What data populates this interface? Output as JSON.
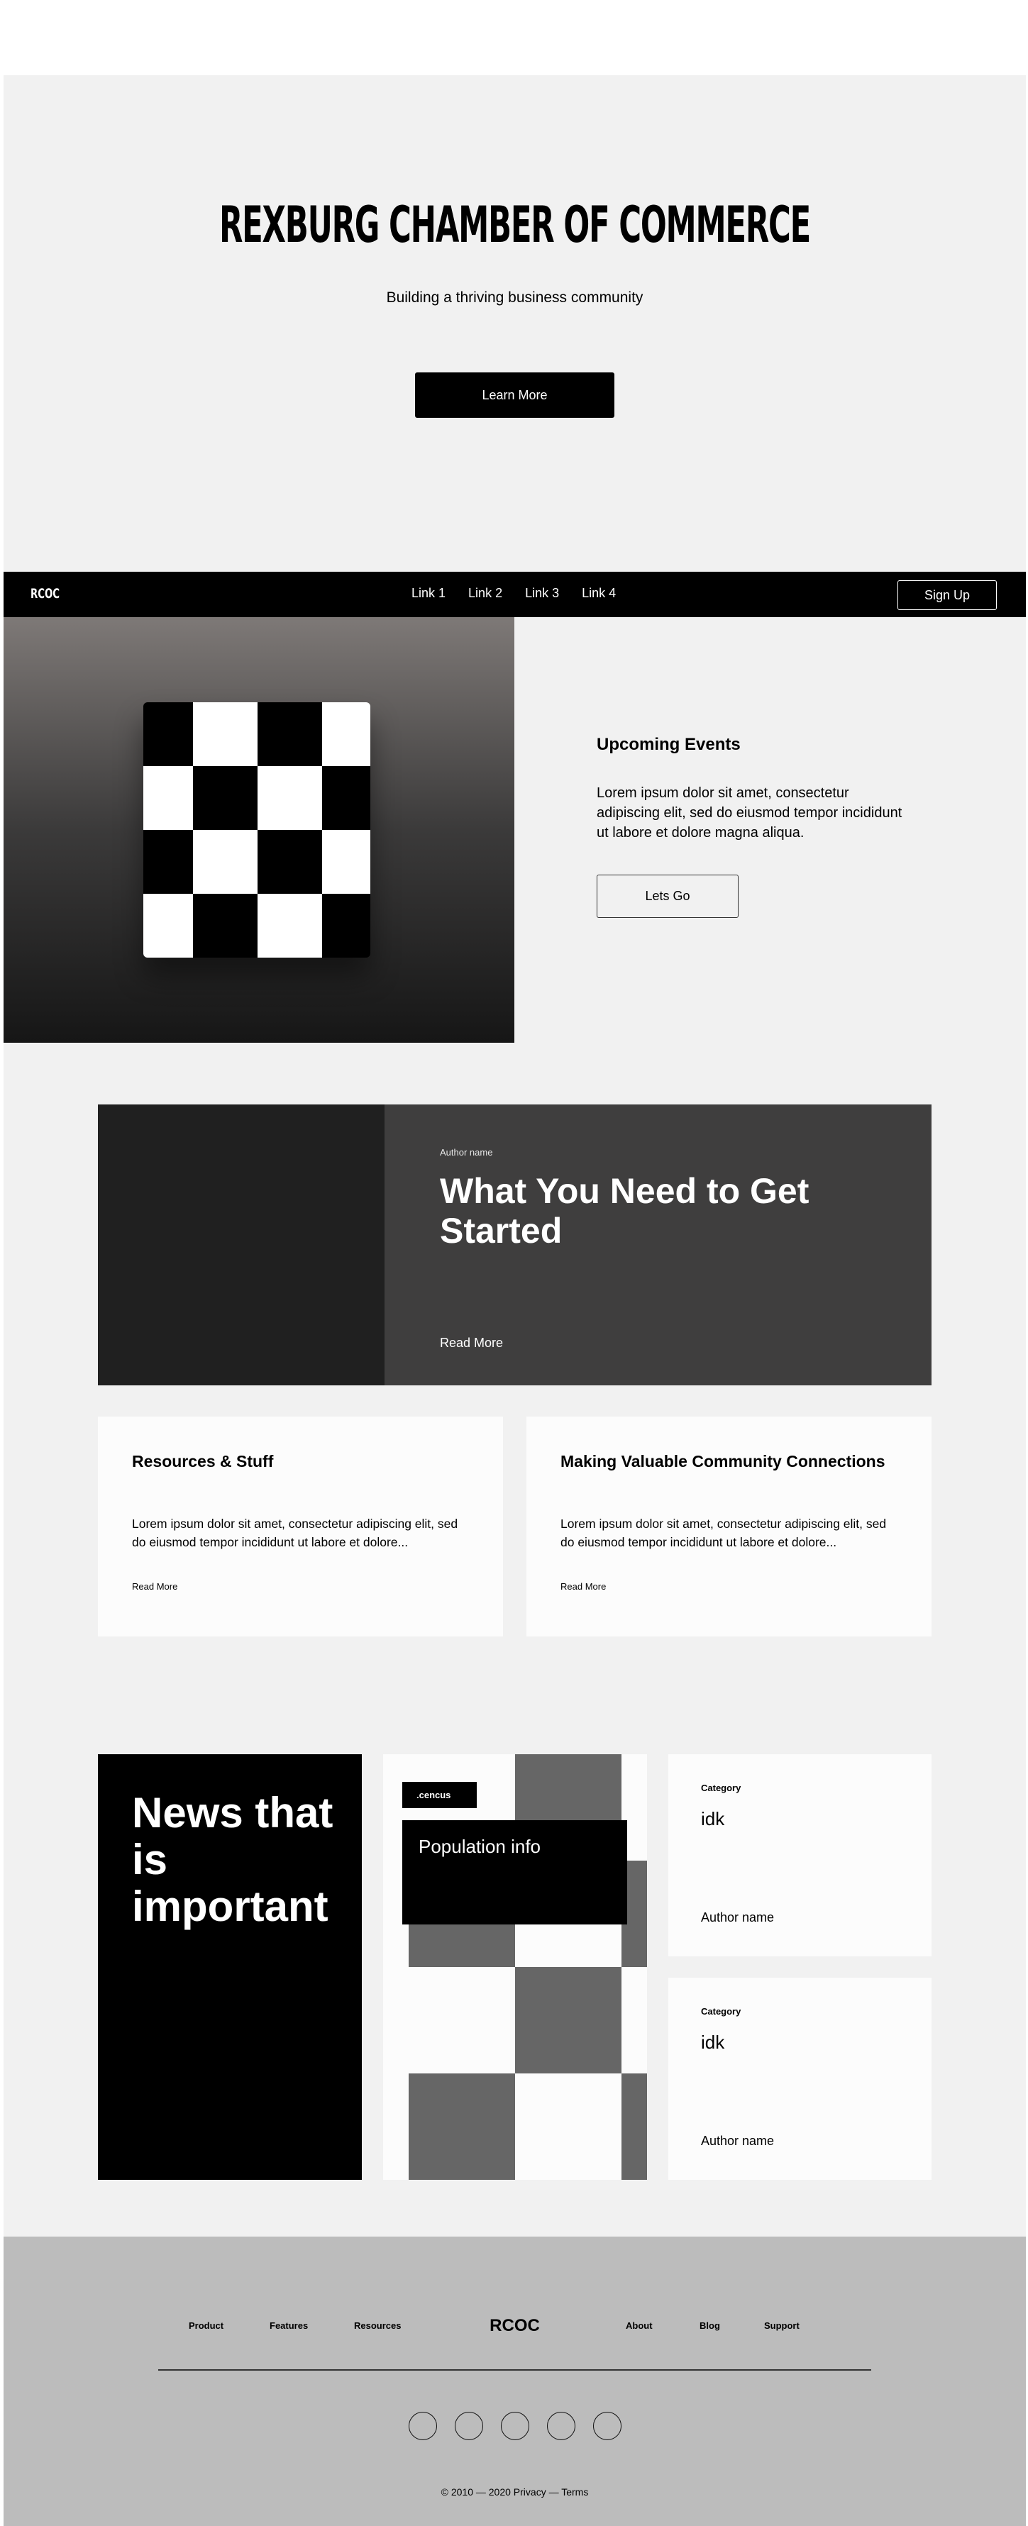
{
  "hero": {
    "title": "REXBURG CHAMBER OF COMMERCE",
    "subtitle": "Building a thriving business community",
    "cta_label": "Learn More"
  },
  "nav": {
    "logo": "RCOC",
    "links": [
      "Link 1",
      "Link 2",
      "Link 3",
      "Link 4"
    ],
    "signup_label": "Sign Up"
  },
  "events": {
    "heading": "Upcoming Events",
    "body": "Lorem ipsum dolor sit amet, consectetur adipiscing elit, sed do eiusmod tempor incididunt ut labore et dolore magna aliqua.",
    "button_label": "Lets Go"
  },
  "featured": {
    "author": "Author name",
    "title": "What You Need to Get Started",
    "read_more": "Read More"
  },
  "cards": [
    {
      "heading": "Resources & Stuff",
      "body": "Lorem ipsum dolor sit amet, consectetur adipiscing elit, sed do eiusmod tempor incididunt ut labore et dolore...",
      "read_more": "Read More"
    },
    {
      "heading": "Making Valuable Community Connections",
      "body": "Lorem ipsum dolor sit amet, consectetur adipiscing elit, sed do eiusmod tempor incididunt ut labore et dolore...",
      "read_more": "Read More"
    }
  ],
  "news": {
    "title": "News that is important"
  },
  "population": {
    "tag": ".cencus",
    "title": "Population info"
  },
  "categories": [
    {
      "label": "Category",
      "value": "idk",
      "author": "Author name"
    },
    {
      "label": "Category",
      "value": "idk",
      "author": "Author name"
    }
  ],
  "footer": {
    "links_left": [
      "Product",
      "Features",
      "Resources"
    ],
    "logo": "RCOC",
    "links_right": [
      "About",
      "Blog",
      "Support"
    ],
    "social_icons": [
      "social-icon-1",
      "social-icon-2",
      "social-icon-3",
      "social-icon-4",
      "social-icon-5"
    ],
    "copyright": "© 2010 — 2020   Privacy — Terms"
  },
  "colors": {
    "page_bg": "#f1f1f1",
    "dark": "#000000",
    "featured_bg": "#3f3e3e",
    "footer_bg": "#bcbcbc",
    "checker_gray": "#666666"
  }
}
